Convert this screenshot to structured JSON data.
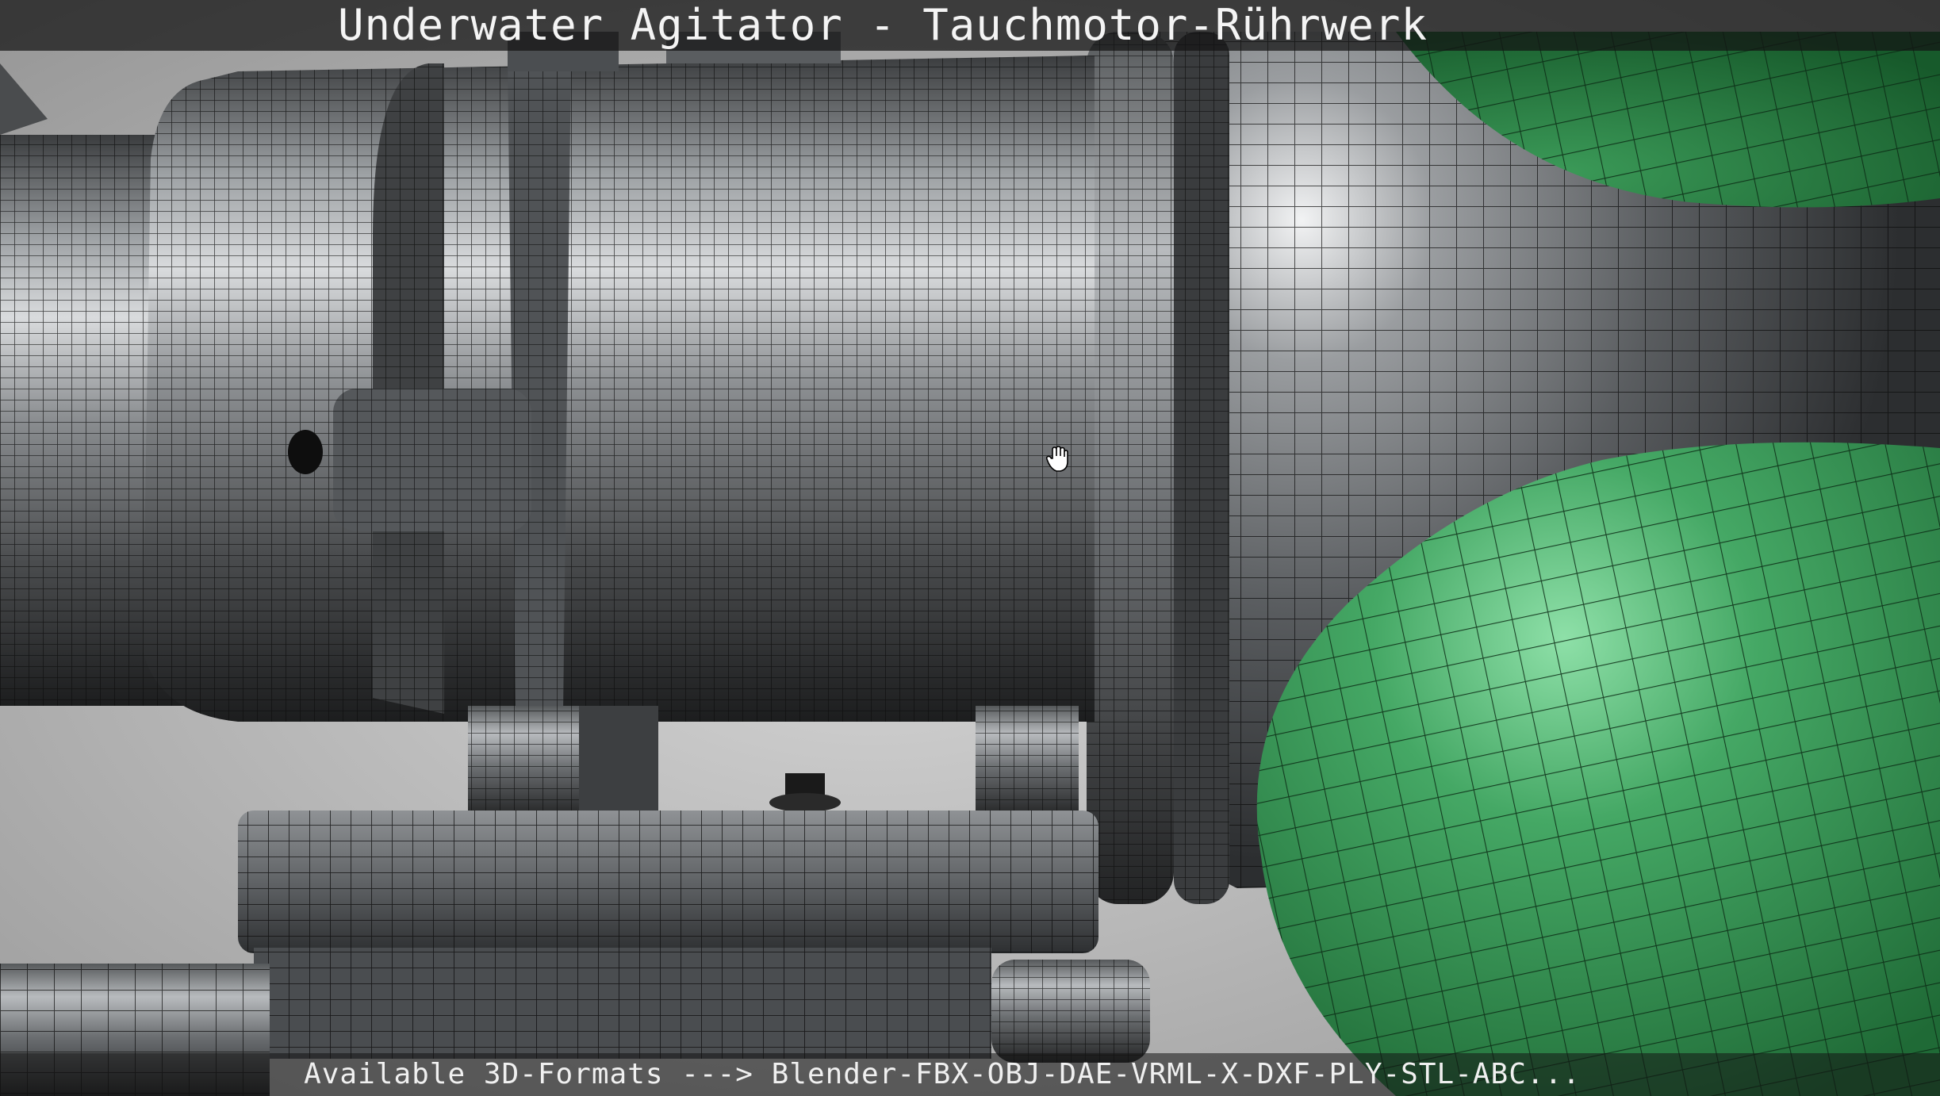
{
  "viewer": {
    "title": "Underwater Agitator - Tauchmotor-Rührwerk",
    "footer": "Available 3D-Formats ---> Blender-FBX-OBJ-DAE-VRML-X-DXF-PLY-STL-ABC..."
  },
  "colors": {
    "background": "#bdbdbd",
    "metal_dark": "#2a2c2e",
    "metal_mid": "#7a7d80",
    "metal_light": "#d6d8da",
    "propeller_green": "#3f9a5c",
    "propeller_highlight": "#7fd39a",
    "wire": "#111111",
    "overlay_bar": "#141414",
    "text": "#f4f4f4"
  },
  "icons": {
    "cursor": "hand-cursor-icon"
  }
}
